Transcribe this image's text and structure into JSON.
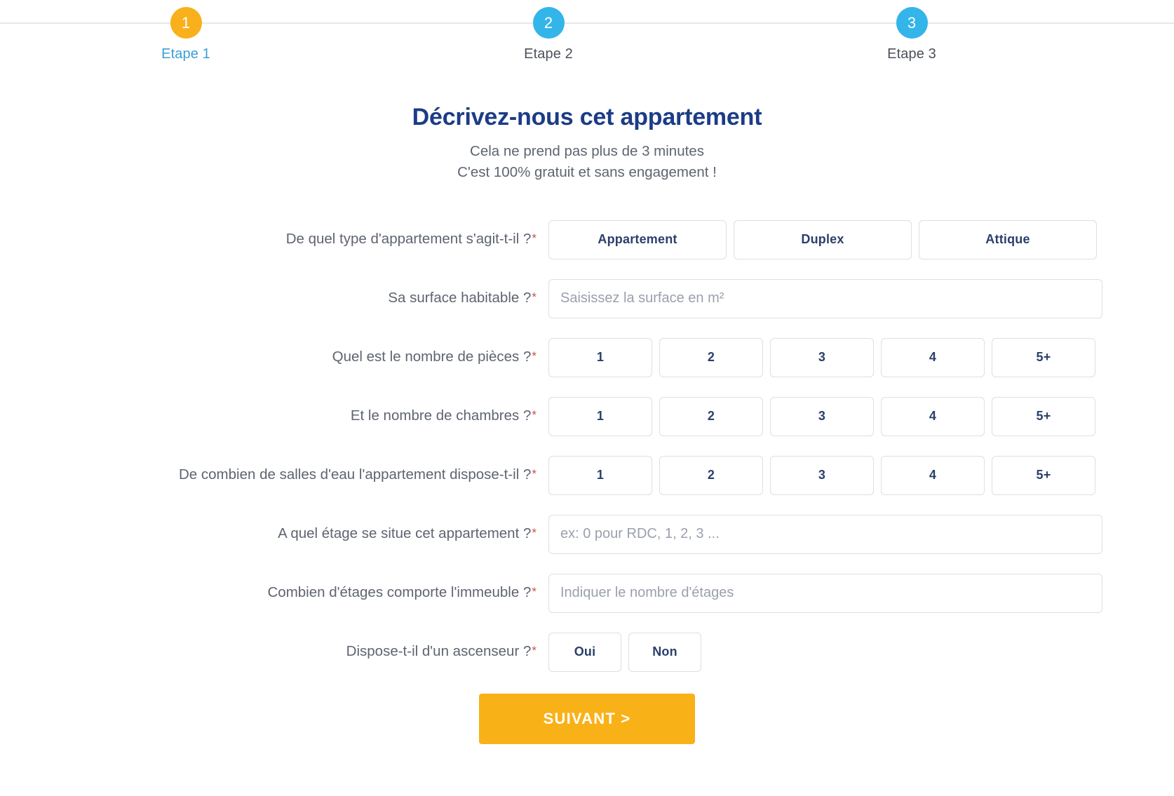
{
  "stepper": {
    "steps": [
      {
        "number": "1",
        "label": "Etape 1",
        "state": "active"
      },
      {
        "number": "2",
        "label": "Etape 2",
        "state": "idle"
      },
      {
        "number": "3",
        "label": "Etape 3",
        "state": "idle"
      }
    ],
    "active_color": "#f9b01c",
    "idle_color": "#33b5e9",
    "active_label_color": "#3a9fd4"
  },
  "heading": {
    "title": "Décrivez-nous cet appartement",
    "subtitle_line1": "Cela ne prend pas plus de 3 minutes",
    "subtitle_line2": "C'est 100% gratuit et sans engagement !",
    "title_color": "#1c3c86"
  },
  "form": {
    "required_marker": "*",
    "rows": {
      "type": {
        "label": "De quel type d'appartement s'agit-t-il ?",
        "options": [
          "Appartement",
          "Duplex",
          "Attique"
        ]
      },
      "surface": {
        "label": "Sa surface habitable ?",
        "placeholder": "Saisissez la surface en m²",
        "value": ""
      },
      "pieces": {
        "label": "Quel est le nombre de pièces ?",
        "options": [
          "1",
          "2",
          "3",
          "4",
          "5+"
        ]
      },
      "chambres": {
        "label": "Et le nombre de chambres ?",
        "options": [
          "1",
          "2",
          "3",
          "4",
          "5+"
        ]
      },
      "salles_eau": {
        "label": "De combien de salles d'eau l'appartement dispose-t-il ?",
        "options": [
          "1",
          "2",
          "3",
          "4",
          "5+"
        ]
      },
      "etage": {
        "label": "A quel étage se situe cet appartement ?",
        "placeholder": "ex: 0 pour RDC, 1, 2, 3 ...",
        "value": ""
      },
      "etages_immeuble": {
        "label": "Combien d'étages comporte l'immeuble ?",
        "placeholder": "Indiquer le nombre d'étages",
        "value": ""
      },
      "ascenseur": {
        "label": "Dispose-t-il d'un ascenseur ?",
        "options": [
          "Oui",
          "Non"
        ]
      }
    }
  },
  "submit": {
    "label": "SUIVANT  >",
    "color": "#f9b118"
  }
}
